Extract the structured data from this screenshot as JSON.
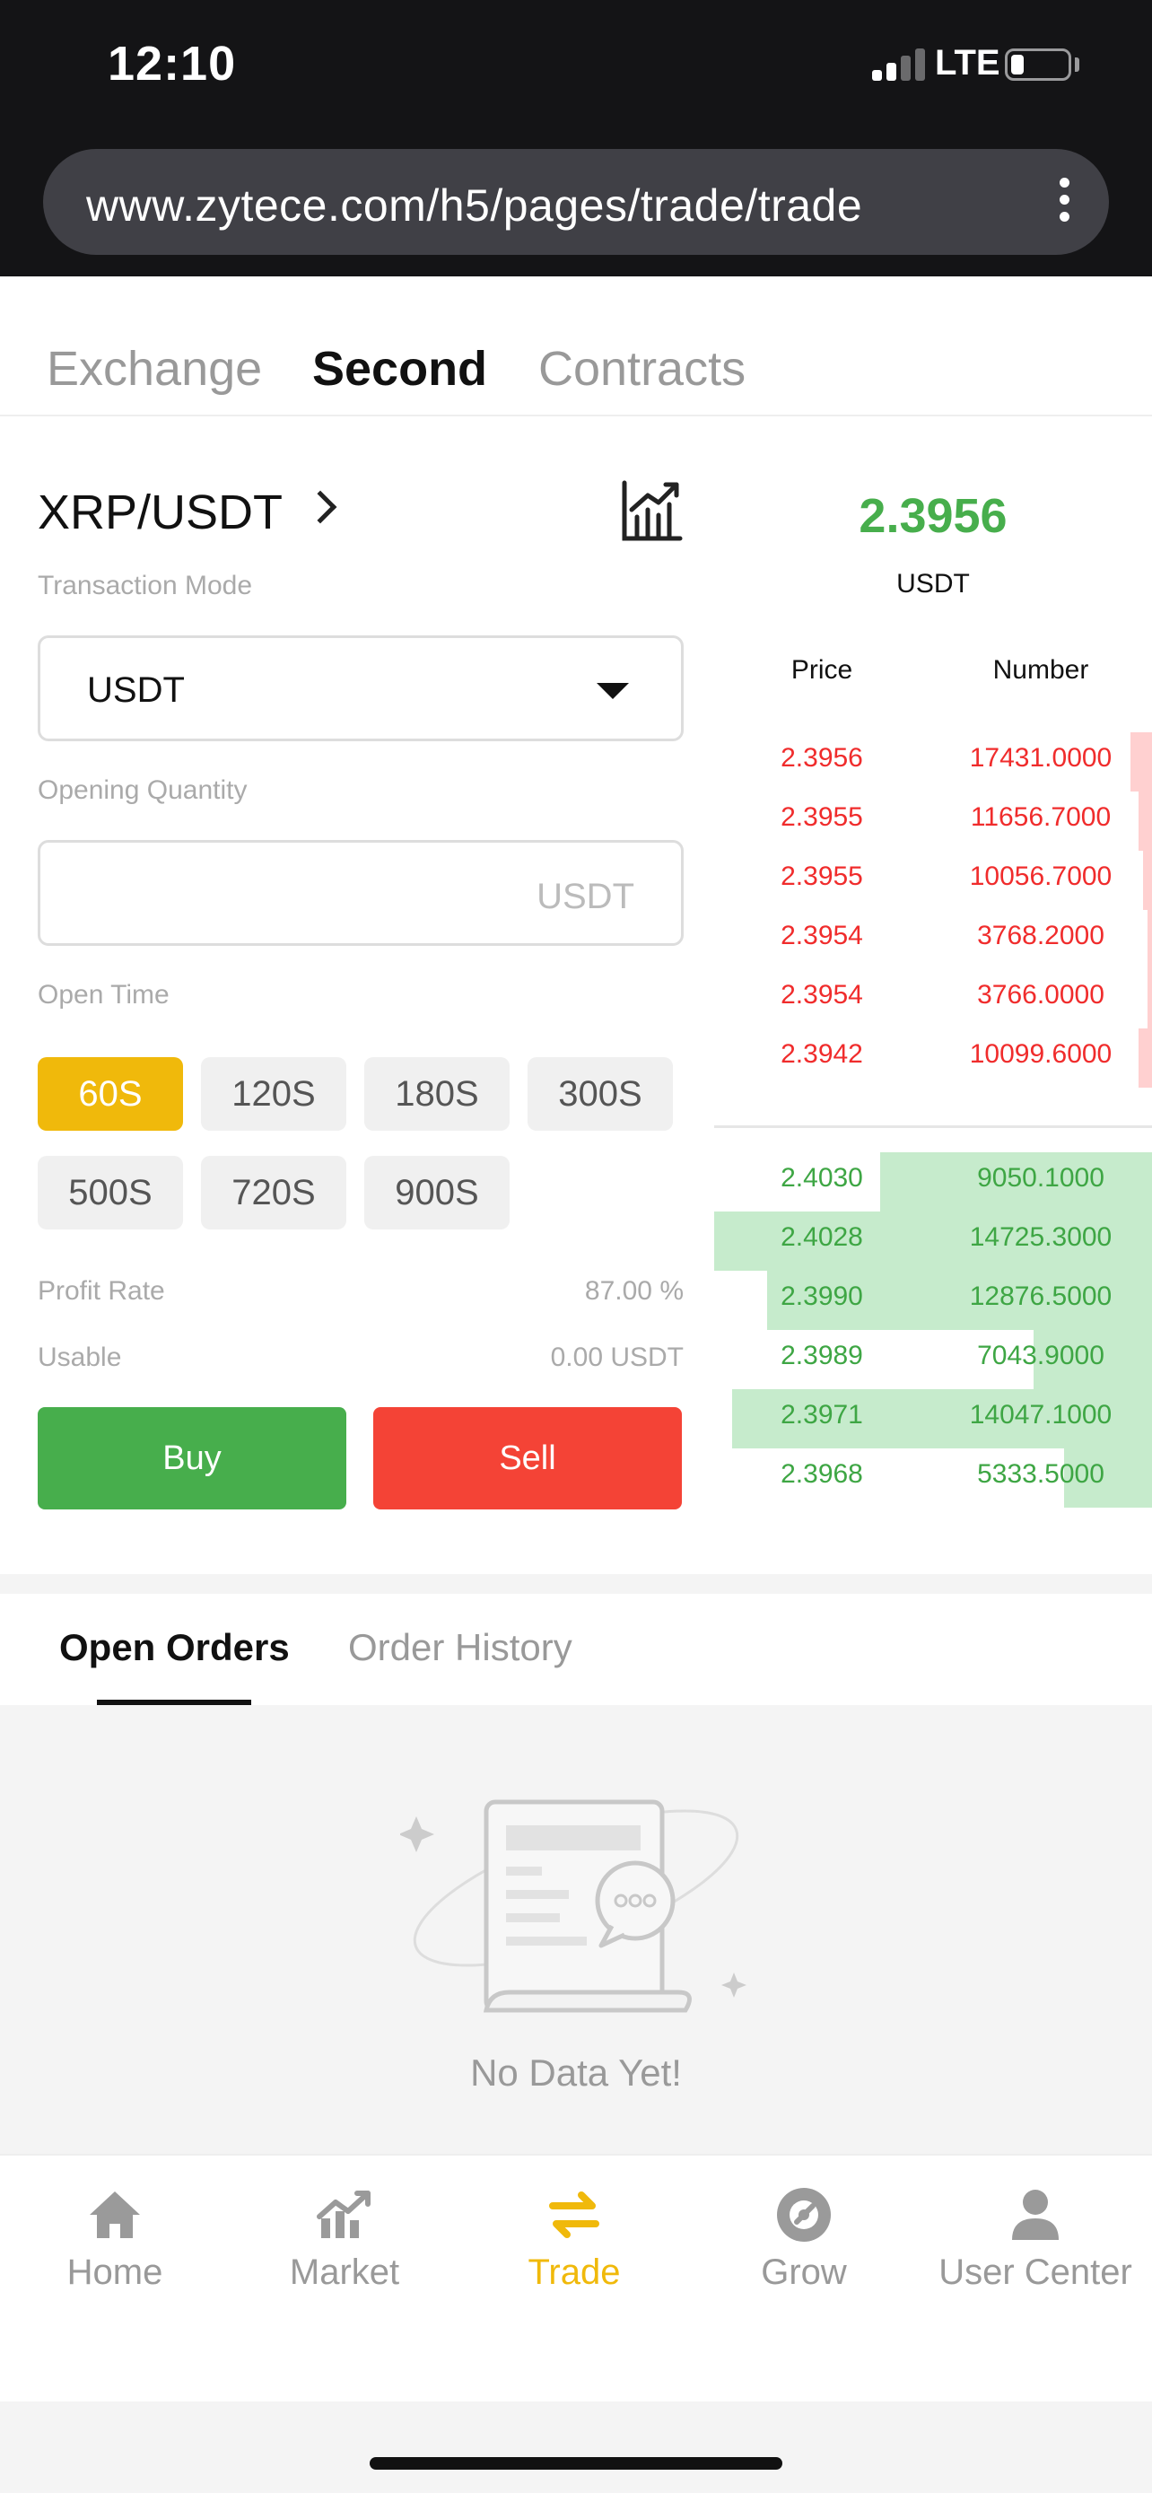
{
  "status_bar": {
    "time": "12:10",
    "network": "LTE"
  },
  "browser": {
    "url": "www.zytece.com/h5/pages/trade/trade"
  },
  "mode_tabs": [
    {
      "label": "Exchange",
      "active": false
    },
    {
      "label": "Second",
      "active": true
    },
    {
      "label": "Contracts",
      "active": false
    }
  ],
  "trade": {
    "pair": "XRP/USDT",
    "transaction_mode_label": "Transaction Mode",
    "transaction_mode_value": "USDT",
    "opening_quantity_label": "Opening Quantity",
    "opening_quantity_unit": "USDT",
    "open_time_label": "Open Time",
    "time_options": [
      "60S",
      "120S",
      "180S",
      "300S",
      "500S",
      "720S",
      "900S"
    ],
    "selected_time": "60S",
    "profit_rate_label": "Profit Rate",
    "profit_rate_value": "87.00 %",
    "usable_label": "Usable",
    "usable_value": "0.00 USDT",
    "buy_label": "Buy",
    "sell_label": "Sell"
  },
  "order_book": {
    "last_price": "2.3956",
    "unit": "USDT",
    "price_header": "Price",
    "number_header": "Number",
    "asks": [
      {
        "price": "2.3956",
        "number": "17431.0000",
        "depth": 0.05
      },
      {
        "price": "2.3955",
        "number": "11656.7000",
        "depth": 0.03
      },
      {
        "price": "2.3955",
        "number": "10056.7000",
        "depth": 0.02
      },
      {
        "price": "2.3954",
        "number": "3768.2000",
        "depth": 0.01
      },
      {
        "price": "2.3954",
        "number": "3766.0000",
        "depth": 0.01
      },
      {
        "price": "2.3942",
        "number": "10099.6000",
        "depth": 0.03
      }
    ],
    "bids": [
      {
        "price": "2.4030",
        "number": "9050.1000",
        "depth": 0.62
      },
      {
        "price": "2.4028",
        "number": "14725.3000",
        "depth": 1.0
      },
      {
        "price": "2.3990",
        "number": "12876.5000",
        "depth": 0.88
      },
      {
        "price": "2.3989",
        "number": "7043.9000",
        "depth": 0.27
      },
      {
        "price": "2.3971",
        "number": "14047.1000",
        "depth": 0.96
      },
      {
        "price": "2.3968",
        "number": "5333.5000",
        "depth": 0.2
      }
    ],
    "ask_color": "#f02c2c",
    "bid_color": "#3ea644"
  },
  "orders": {
    "tabs": [
      {
        "label": "Open Orders",
        "active": true
      },
      {
        "label": "Order History",
        "active": false
      }
    ],
    "empty_text": "No Data Yet!"
  },
  "bottom_nav": [
    {
      "label": "Home",
      "icon": "home-icon",
      "active": false
    },
    {
      "label": "Market",
      "icon": "market-chart-icon",
      "active": false
    },
    {
      "label": "Trade",
      "icon": "trade-swap-icon",
      "active": true
    },
    {
      "label": "Grow",
      "icon": "grow-icon",
      "active": false
    },
    {
      "label": "User Center",
      "icon": "user-icon",
      "active": false
    }
  ],
  "colors": {
    "accent": "#f0b90b",
    "buy": "#47ae4c",
    "sell": "#f44336"
  }
}
